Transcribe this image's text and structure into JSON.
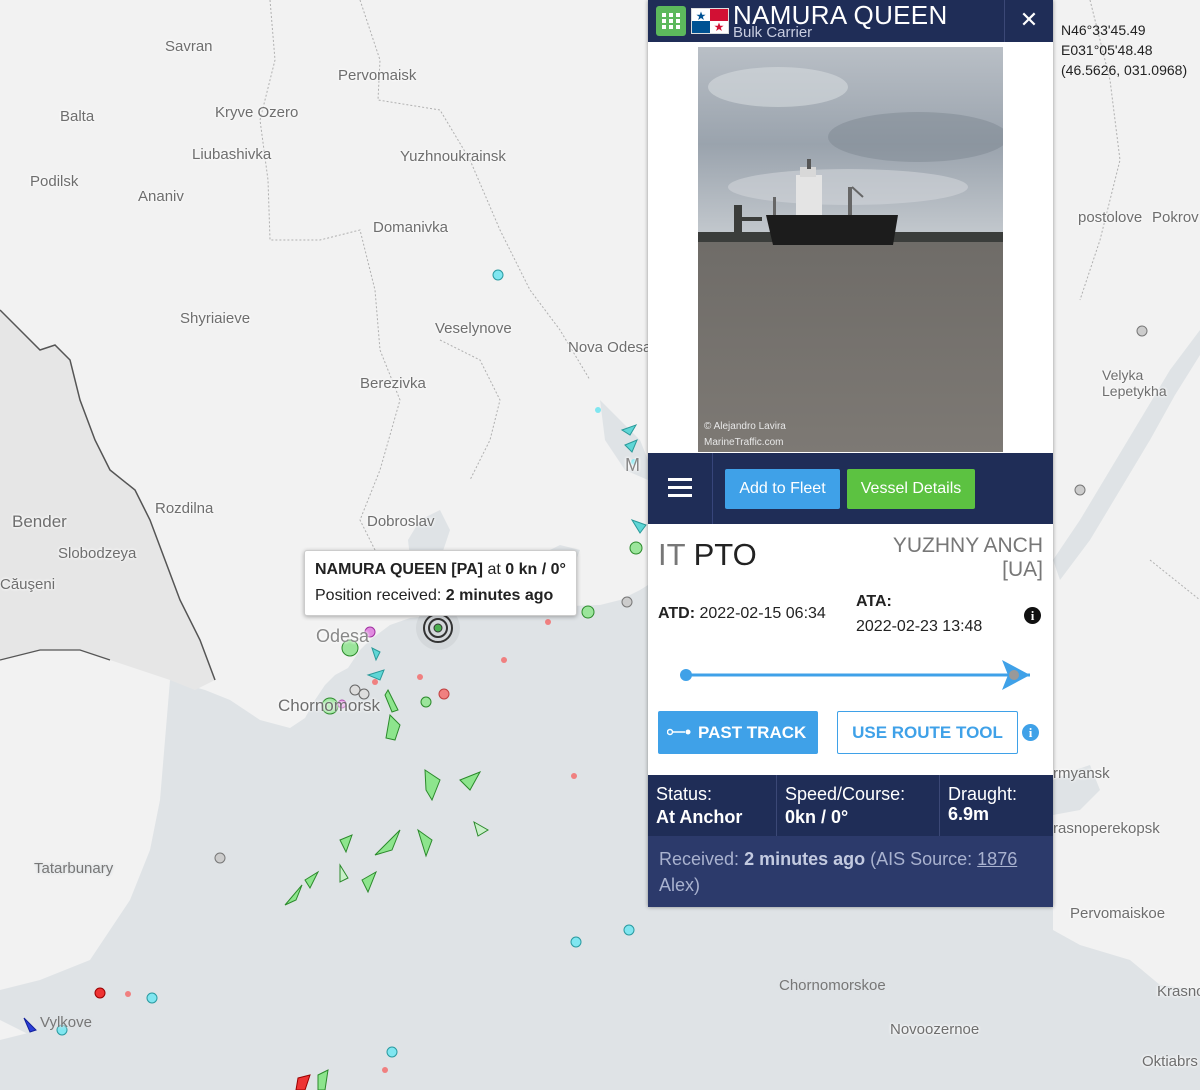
{
  "map": {
    "places": [
      {
        "name": "Savran"
      },
      {
        "name": "Pervomaisk"
      },
      {
        "name": "Balta"
      },
      {
        "name": "Kryve Ozero"
      },
      {
        "name": "Liubashivka"
      },
      {
        "name": "Yuzhnoukrainsk"
      },
      {
        "name": "Podilsk"
      },
      {
        "name": "Ananiv"
      },
      {
        "name": "Domanivka"
      },
      {
        "name": "Shyriaieve"
      },
      {
        "name": "Veselynove"
      },
      {
        "name": "Nova Odesa"
      },
      {
        "name": "Berezivka"
      },
      {
        "name": "Bender"
      },
      {
        "name": "Rozdilna"
      },
      {
        "name": "Slobodzeya"
      },
      {
        "name": "Dobroslav"
      },
      {
        "name": "Căuşeni"
      },
      {
        "name": "Odesa"
      },
      {
        "name": "Chornomorsk"
      },
      {
        "name": "Tatarbunary"
      },
      {
        "name": "Vylkove"
      },
      {
        "name": "postolove"
      },
      {
        "name": "Pokrov"
      },
      {
        "name": "Velyka Lepetykha"
      },
      {
        "name": "rmyansk"
      },
      {
        "name": "rasnoperekopsk"
      },
      {
        "name": "Pervomaiskoe"
      },
      {
        "name": "Chornomorskoe"
      },
      {
        "name": "Krasno"
      },
      {
        "name": "Novoozernoe"
      },
      {
        "name": "Oktiabrs"
      },
      {
        "name": "M"
      }
    ]
  },
  "coords": {
    "lat": "N46°33'45.49",
    "lon": "E031°05'48.48",
    "decimal": "(46.5626, 031.0968)"
  },
  "tooltip": {
    "name": "NAMURA QUEEN [PA]",
    "at": "at",
    "speed": "0 kn / 0°",
    "received_label": "Position received:",
    "received_value": "2 minutes ago"
  },
  "vessel": {
    "name": "NAMURA QUEEN",
    "type": "Bulk Carrier",
    "close": "✕",
    "photo_credit1": "© Alejandro Lavira",
    "photo_credit2": "MarineTraffic.com"
  },
  "toolbar": {
    "add_fleet": "Add to Fleet",
    "vessel_details": "Vessel Details"
  },
  "voyage": {
    "from_cc": "IT",
    "from_port": "PTO",
    "to_port": "YUZHNY ANCH",
    "to_cc": "[UA]",
    "atd_label": "ATD:",
    "atd_value": "2022-02-15 06:34",
    "ata_label": "ATA:",
    "ata_value": "2022-02-23 13:48",
    "progress": 1.0,
    "past_track": "PAST TRACK",
    "route_tool": "USE ROUTE TOOL"
  },
  "stats": {
    "status_label": "Status:",
    "status_value": "At Anchor",
    "speed_label": "Speed/Course:",
    "speed_value": "0kn / 0°",
    "draught_label": "Draught:",
    "draught_value": "6.9m"
  },
  "received": {
    "label": "Received:",
    "value": "2 minutes ago",
    "source_label": "(AIS Source:",
    "source_id": "1876",
    "source_name": "Alex)"
  },
  "colors": {
    "panel_header": "#1f2d57",
    "blue_button": "#3fa1e8",
    "green_button": "#5cc241",
    "sea": "#dfe3e6",
    "land": "#f2f2f2"
  }
}
